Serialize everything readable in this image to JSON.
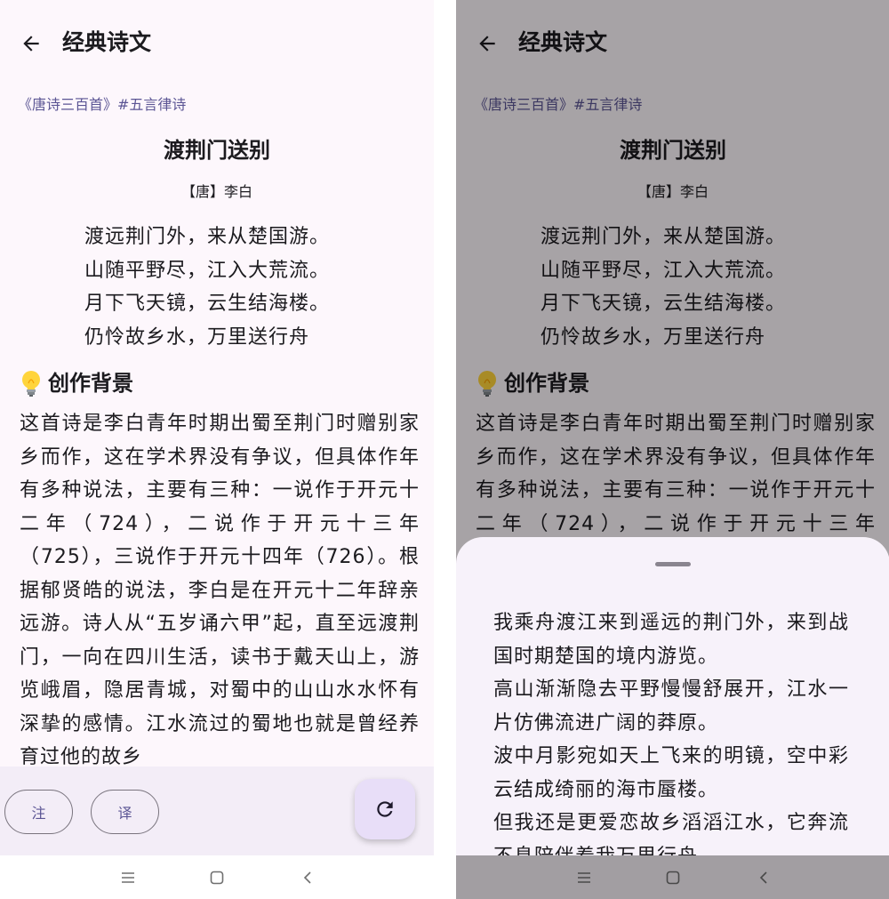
{
  "appbar": {
    "title": "经典诗文"
  },
  "poem": {
    "tags": "《唐诗三百首》#五言律诗",
    "title": "渡荆门送别",
    "author": "【唐】李白",
    "lines": [
      "渡远荆门外，来从楚国游。",
      "山随平野尽，江入大荒流。",
      "月下飞天镜，云生结海楼。",
      "仍怜故乡水，万里送行舟"
    ]
  },
  "background_section": {
    "icon": "lightbulb-icon",
    "title": "创作背景",
    "text": "这首诗是李白青年时期出蜀至荆门时赠别家乡而作，这在学术界没有争议，但具体作年有多种说法，主要有三种：一说作于开元十二年（724），二说作于开元十三年（725），三说作于开元十四年（726）。根据郁贤皓的说法，李白是在开元十二年辞亲远游。诗人从“五岁诵六甲”起，直至远渡荆门，一向在四川生活，读书于戴天山上，游览峨眉，隐居青城，对蜀中的山山水水怀有深挚的感情。江水流过的蜀地也就是曾经养育过他的故乡"
  },
  "bottom_bar": {
    "note_label": "注",
    "translate_label": "译",
    "refresh_icon": "refresh-icon"
  },
  "translation_sheet": {
    "paragraphs": [
      "我乘舟渡江来到遥远的荆门外，来到战国时期楚国的境内游览。",
      "高山渐渐隐去平野慢慢舒展开，江水一片仿佛流进广阔的莽原。",
      "波中月影宛如天上飞来的明镜，空中彩云结成绮丽的海市蜃楼。",
      "但我还是更爱恋故乡滔滔江水，它奔流不息陪伴着我万里行舟。"
    ]
  },
  "system_nav": {
    "icons": [
      "menu-icon",
      "home-icon",
      "back-nav-icon"
    ]
  },
  "colors": {
    "accent": "#5b5594",
    "surface": "#fdf7fc",
    "bottom_bar": "#f3edf7",
    "fab": "#e8def8",
    "scrim": "rgba(0,0,0,0.34)"
  }
}
